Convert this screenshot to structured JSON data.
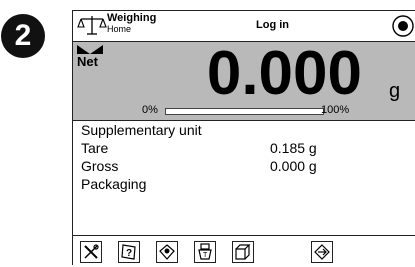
{
  "step_number": "2",
  "header": {
    "mode_title": "Weighing",
    "mode_subtitle": "Home",
    "login_label": "Log in"
  },
  "display": {
    "net_label": "Net",
    "reading": "0.000",
    "unit": "g",
    "bar_min": "0%",
    "bar_max": "100%",
    "capacity_fraction": 0.0
  },
  "info": {
    "rows": [
      {
        "label": "Supplementary unit",
        "value": ""
      },
      {
        "label": "Tare",
        "value": "0.185 g"
      },
      {
        "label": "Gross",
        "value": "0.000 g"
      },
      {
        "label": "Packaging",
        "value": ""
      }
    ]
  },
  "toolbar": {
    "icons": [
      "settings-icon",
      "help-icon",
      "profile-icon",
      "tare-icon",
      "packaging-icon",
      "print-icon"
    ]
  }
}
